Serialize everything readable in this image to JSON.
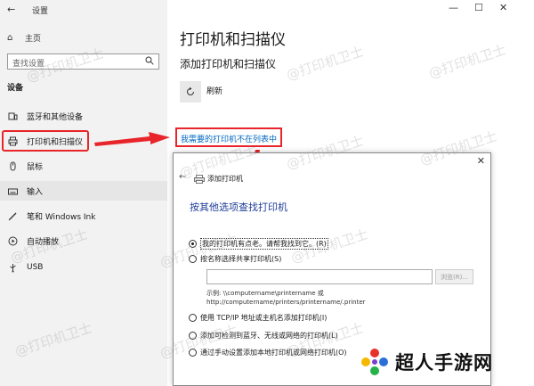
{
  "app": {
    "title": "设置"
  },
  "sidebar": {
    "home_label": "主页",
    "search_placeholder": "查找设置",
    "section_label": "设备",
    "items": [
      {
        "label": "蓝牙和其他设备",
        "icon": "bluetooth-devices-icon"
      },
      {
        "label": "打印机和扫描仪",
        "icon": "printer-icon"
      },
      {
        "label": "鼠标",
        "icon": "mouse-icon"
      },
      {
        "label": "输入",
        "icon": "keyboard-icon"
      },
      {
        "label": "笔和 Windows Ink",
        "icon": "pen-icon"
      },
      {
        "label": "自动播放",
        "icon": "autoplay-icon"
      },
      {
        "label": "USB",
        "icon": "usb-icon"
      }
    ]
  },
  "window_controls": {
    "minimize": "—",
    "maximize": "☐",
    "close": "✕"
  },
  "main": {
    "title": "打印机和扫描仪",
    "subtitle": "添加打印机和扫描仪",
    "refresh_label": "刷新",
    "not_listed_link": "我需要的打印机不在列表中"
  },
  "dialog": {
    "title": "添加打印机",
    "close": "✕",
    "back": "←",
    "heading": "按其他选项查找打印机",
    "options": [
      "我的打印机有点老。请帮我找到它。(R)",
      "按名称选择共享打印机(S)",
      "使用 TCP/IP 地址或主机名添加打印机(I)",
      "添加可检测到蓝牙、无线或网络的打印机(L)",
      "通过手动设置添加本地打印机或网络打印机(O)"
    ],
    "share_input_value": "",
    "browse_label": "浏览(R)...",
    "example_line1": "示例: \\\\computername\\printername 或",
    "example_line2": "http://computername/printers/printername/.printer"
  },
  "watermark": "@打印机卫士",
  "brand": {
    "text": "超人手游网"
  },
  "colors": {
    "highlight": "#e8252a",
    "link": "#0067c0",
    "heading": "#1f3c99"
  }
}
